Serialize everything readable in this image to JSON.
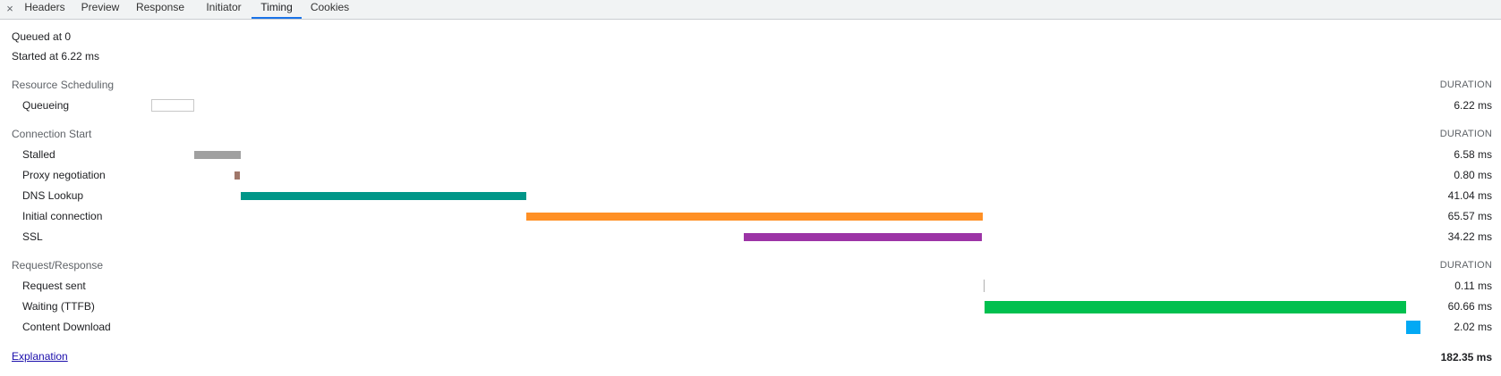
{
  "tabs": {
    "close_glyph": "×",
    "items": [
      {
        "label": "Headers"
      },
      {
        "label": "Preview"
      },
      {
        "label": "Response"
      },
      {
        "label": "Initiator"
      },
      {
        "label": "Timing",
        "active": true
      },
      {
        "label": "Cookies"
      }
    ]
  },
  "summary": {
    "queued": "Queued at 0",
    "started": "Started at 6.22 ms"
  },
  "sections": [
    {
      "title": "Resource Scheduling",
      "duration_header": "DURATION",
      "rows": [
        {
          "label": "Queueing",
          "duration": "6.22 ms"
        }
      ]
    },
    {
      "title": "Connection Start",
      "duration_header": "DURATION",
      "rows": [
        {
          "label": "Stalled",
          "duration": "6.58 ms"
        },
        {
          "label": "Proxy negotiation",
          "duration": "0.80 ms"
        },
        {
          "label": "DNS Lookup",
          "duration": "41.04 ms"
        },
        {
          "label": "Initial connection",
          "duration": "65.57 ms"
        },
        {
          "label": "SSL",
          "duration": "34.22 ms"
        }
      ]
    },
    {
      "title": "Request/Response",
      "duration_header": "DURATION",
      "rows": [
        {
          "label": "Request sent",
          "duration": "0.11 ms"
        },
        {
          "label": "Waiting (TTFB)",
          "duration": "60.66 ms"
        },
        {
          "label": "Content Download",
          "duration": "2.02 ms"
        }
      ]
    }
  ],
  "footer": {
    "explanation": "Explanation",
    "total": "182.35 ms"
  },
  "colors": {
    "queueing_border": "#c8c8c8",
    "stalled": "#a0a0a0",
    "proxy": "#a0776a",
    "dns": "#009688",
    "initial_connection": "#ff9025",
    "ssl": "#9c34a6",
    "request_sent": "#b0b0b0",
    "waiting": "#00c04f",
    "content_download": "#03a9f4",
    "active_tab": "#1a73e8"
  }
}
